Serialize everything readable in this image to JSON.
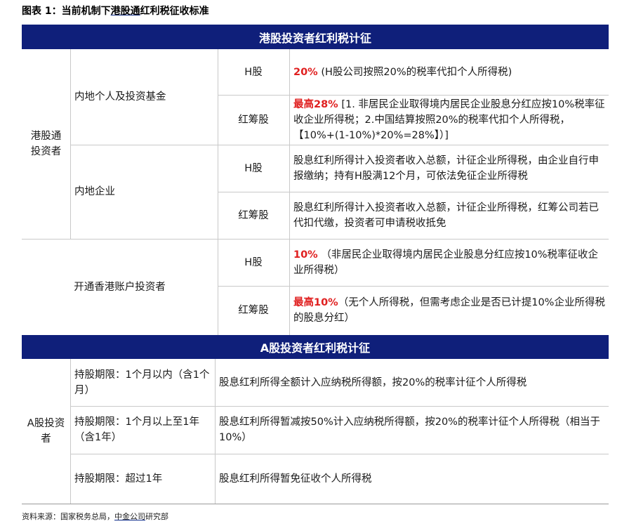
{
  "figure": {
    "title_pre": "图表 1：当前机制下",
    "title_underlined": "港股通",
    "title_post": "红利税征收标准"
  },
  "section_hk": {
    "header": "港股投资者红利税计征",
    "investor_group": "港股通投资者",
    "rows": [
      {
        "investor": "内地个人及投资基金",
        "share": "H股",
        "highlight": "20%",
        "text": " (H股公司按照20%的税率代扣个人所得税)"
      },
      {
        "investor": "",
        "share": "红筹股",
        "highlight": "最高28%",
        "text": " [1. 非居民企业取得境内居民企业股息分红应按10%税率征收企业所得税；2.中国结算按照20%的税率代扣个人所得税，【10%+(1-10%)*20%=28%】）]"
      },
      {
        "investor": "内地企业",
        "share": "H股",
        "highlight": "",
        "text": "股息红利所得计入投资者收入总额，计征企业所得税，由企业自行申报缴纳；持有H股满12个月，可依法免征企业所得税"
      },
      {
        "investor": "",
        "share": "红筹股",
        "highlight": "",
        "text": "股息红利所得计入投资者收入总额，计征企业所得税，红筹公司若已代扣代缴，投资者可申请税收抵免"
      },
      {
        "investor": "开通香港账户投资者",
        "share": "H股",
        "highlight": "10%",
        "text": " （非居民企业取得境内居民企业股息分红应按10%税率征收企业所得税）"
      },
      {
        "investor": "",
        "share": "红筹股",
        "highlight": "最高10%",
        "text": "（无个人所得税，但需考虑企业是否已计提10%企业所得税的股息分红）"
      }
    ]
  },
  "section_a": {
    "header": "A股投资者红利税计征",
    "investor_group": "A股投资者",
    "rows": [
      {
        "period": "持股期限：1个月以内（含1个月）",
        "text": "股息红利所得全额计入应纳税所得额，按20%的税率计征个人所得税"
      },
      {
        "period": "持股期限：1个月以上至1年（含1年）",
        "text": "股息红利所得暂减按50%计入应纳税所得额，按20%的税率计征个人所得税（相当于10%）"
      },
      {
        "period": "持股期限：超过1年",
        "text": "股息红利所得暂免征收个人所得税"
      }
    ]
  },
  "source": {
    "prefix": "资料来源：国家税务总局，",
    "underlined": "中金公司",
    "suffix": "研究部"
  },
  "colors": {
    "band": "#0f1f7a",
    "highlight": "#e02020",
    "rule": "#c9c9c9"
  }
}
